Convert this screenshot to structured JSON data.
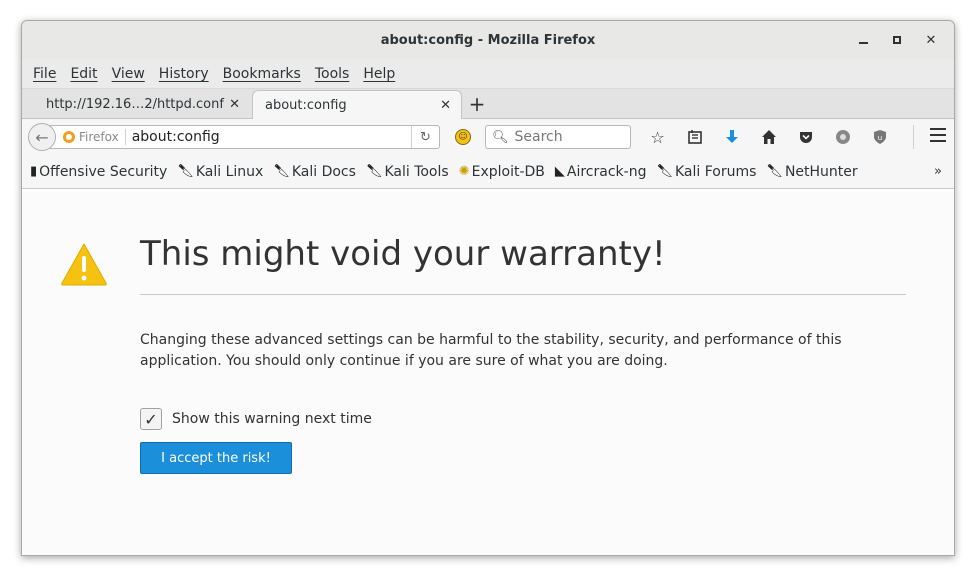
{
  "window": {
    "title": "about:config - Mozilla Firefox"
  },
  "menubar": {
    "items": [
      "File",
      "Edit",
      "View",
      "History",
      "Bookmarks",
      "Tools",
      "Help"
    ]
  },
  "tabs": [
    {
      "label": "http://192.16…2/httpd.conf",
      "active": false
    },
    {
      "label": "about:config",
      "active": true
    }
  ],
  "navbar": {
    "identity_label": "Firefox",
    "url": "about:config",
    "search_placeholder": "Search"
  },
  "bookmarks": [
    {
      "label": "Offensive Security",
      "icon": "offsec-icon"
    },
    {
      "label": "Kali Linux",
      "icon": "kali-dragon-icon"
    },
    {
      "label": "Kali Docs",
      "icon": "kali-dragon-icon"
    },
    {
      "label": "Kali Tools",
      "icon": "kali-dragon-icon"
    },
    {
      "label": "Exploit-DB",
      "icon": "exploitdb-icon"
    },
    {
      "label": "Aircrack-ng",
      "icon": "aircrack-icon"
    },
    {
      "label": "Kali Forums",
      "icon": "kali-dragon-icon"
    },
    {
      "label": "NetHunter",
      "icon": "kali-dragon-icon"
    }
  ],
  "content": {
    "heading": "This might void your warranty!",
    "body": "Changing these advanced settings can be harmful to the stability, security, and performance of this application. You should only continue if you are sure of what you are doing.",
    "checkbox_label": "Show this warning next time",
    "checkbox_checked": true,
    "accept_button": "I accept the risk!"
  },
  "colors": {
    "accent": "#1b8fd9",
    "warning": "#f5c211"
  }
}
